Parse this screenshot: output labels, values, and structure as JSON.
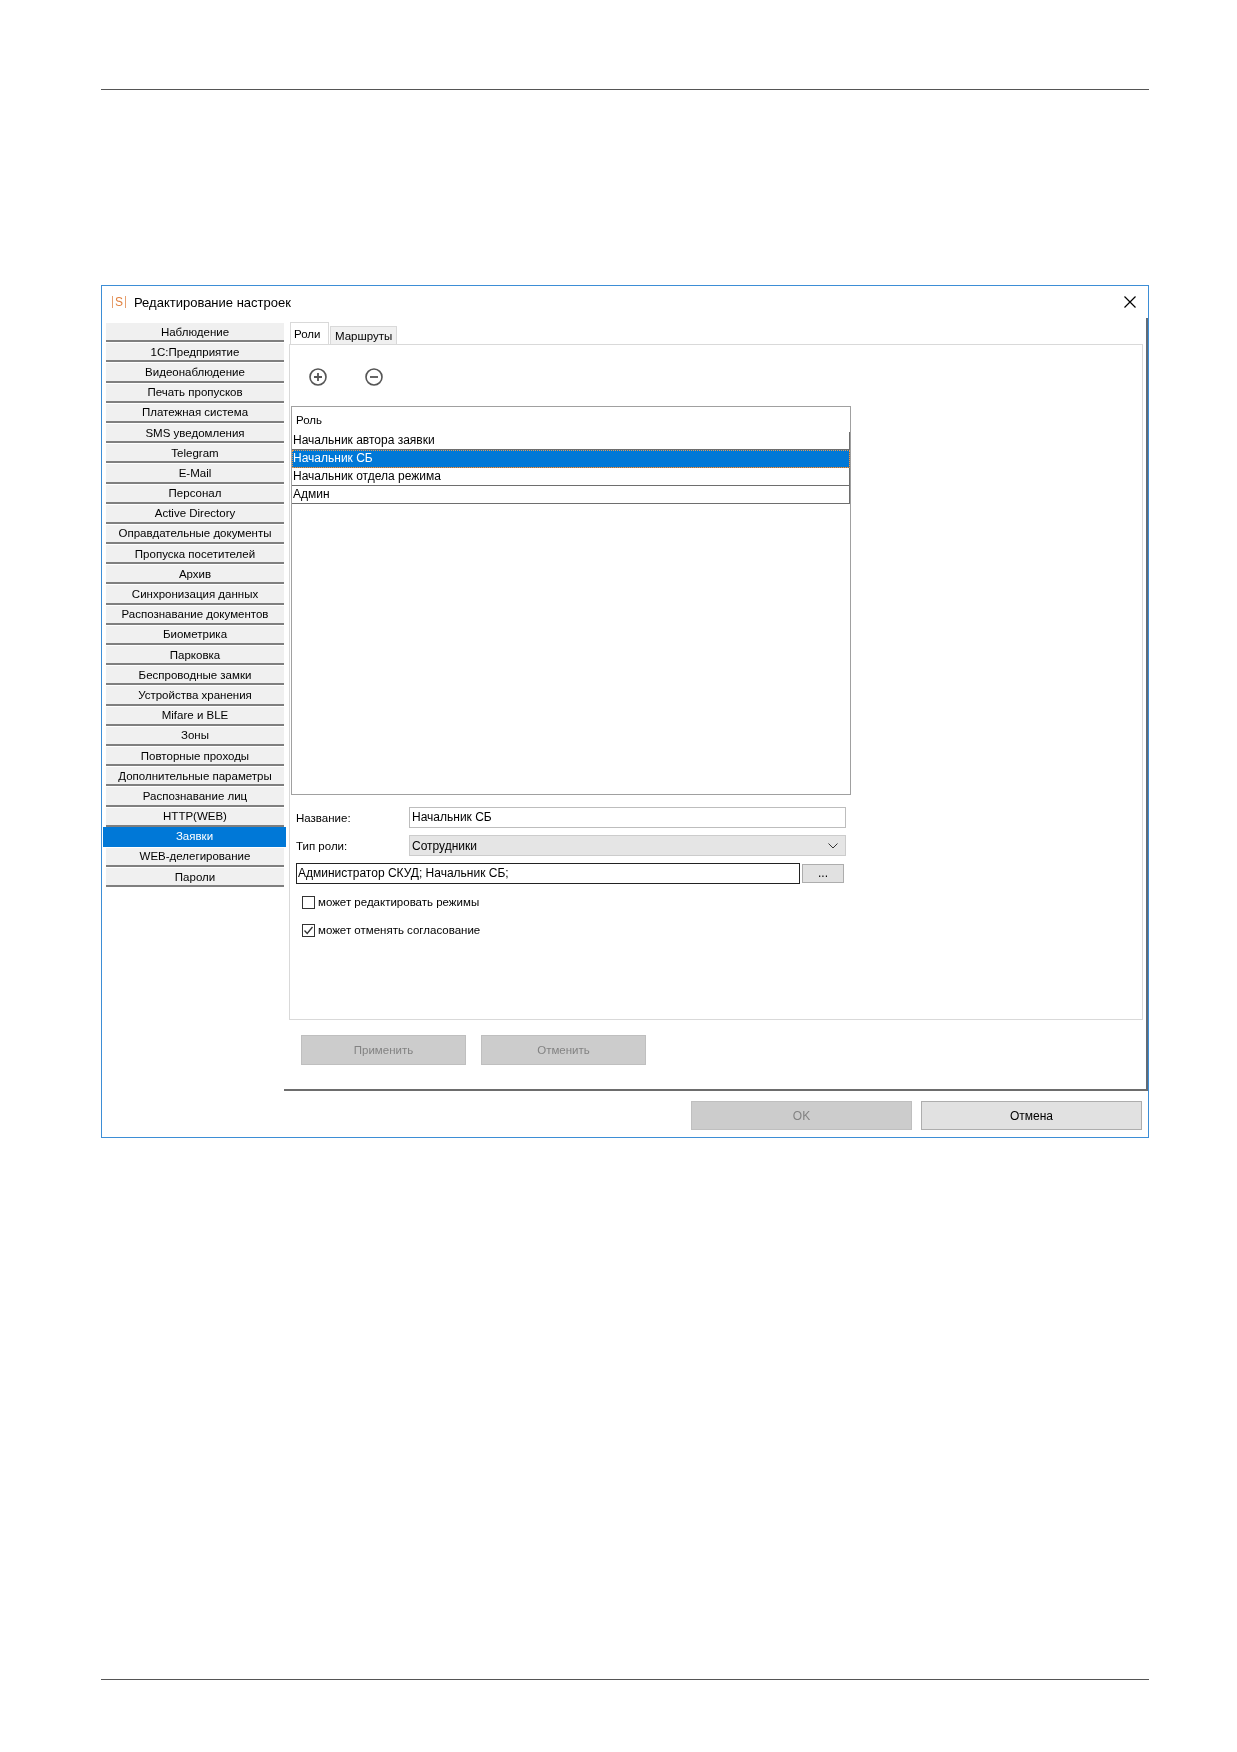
{
  "window": {
    "logo": "S",
    "title": "Редактирование настроек"
  },
  "sidebar": {
    "items": [
      {
        "label": "Наблюдение",
        "selected": false
      },
      {
        "label": "1С:Предприятие",
        "selected": false
      },
      {
        "label": "Видеонаблюдение",
        "selected": false
      },
      {
        "label": "Печать пропусков",
        "selected": false
      },
      {
        "label": "Платежная система",
        "selected": false
      },
      {
        "label": "SMS уведомления",
        "selected": false
      },
      {
        "label": "Telegram",
        "selected": false
      },
      {
        "label": "E-Mail",
        "selected": false
      },
      {
        "label": "Персонал",
        "selected": false
      },
      {
        "label": "Active Directory",
        "selected": false
      },
      {
        "label": "Оправдательные документы",
        "selected": false
      },
      {
        "label": "Пропуска посетителей",
        "selected": false
      },
      {
        "label": "Архив",
        "selected": false
      },
      {
        "label": "Синхронизация данных",
        "selected": false
      },
      {
        "label": "Распознавание документов",
        "selected": false
      },
      {
        "label": "Биометрика",
        "selected": false
      },
      {
        "label": "Парковка",
        "selected": false
      },
      {
        "label": "Беспроводные замки",
        "selected": false
      },
      {
        "label": "Устройства хранения",
        "selected": false
      },
      {
        "label": "Mifare и BLE",
        "selected": false
      },
      {
        "label": "Зоны",
        "selected": false
      },
      {
        "label": "Повторные проходы",
        "selected": false
      },
      {
        "label": "Дополнительные параметры",
        "selected": false
      },
      {
        "label": "Распознавание лиц",
        "selected": false
      },
      {
        "label": "HTTP(WEB)",
        "selected": false
      },
      {
        "label": "Заявки",
        "selected": true
      },
      {
        "label": "WEB-делегирование",
        "selected": false
      },
      {
        "label": "Пароли",
        "selected": false
      }
    ]
  },
  "tabs": [
    {
      "label": "Роли",
      "selected": true
    },
    {
      "label": "Маршруты",
      "selected": false
    }
  ],
  "roles_table": {
    "header": "Роль",
    "rows": [
      {
        "label": "Начальник автора заявки",
        "selected": false
      },
      {
        "label": "Начальник СБ",
        "selected": true
      },
      {
        "label": "Начальник отдела режима",
        "selected": false
      },
      {
        "label": "Админ",
        "selected": false
      }
    ]
  },
  "role_form": {
    "name_label": "Название:",
    "name_value": "Начальник СБ",
    "type_label": "Тип роли:",
    "type_value": "Сотрудники",
    "members_value": "Администратор СКУД; Начальник СБ;",
    "browse_button": "...",
    "options": [
      {
        "label": "может редактировать режимы",
        "checked": false
      },
      {
        "label": "может отменять согласование",
        "checked": true
      }
    ],
    "buttons": [
      {
        "label": "Применить",
        "disabled": true
      },
      {
        "label": "Отменить",
        "disabled": true
      }
    ]
  },
  "dialog_buttons": [
    {
      "label": "OK",
      "disabled": true
    },
    {
      "label": "Отмена",
      "disabled": false
    }
  ]
}
